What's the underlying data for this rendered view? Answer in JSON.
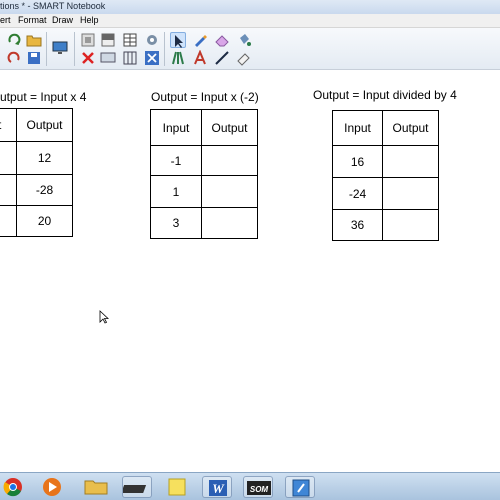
{
  "window": {
    "title": "tions * - SMART Notebook"
  },
  "menu": [
    "ert",
    "Format",
    "Draw",
    "Help"
  ],
  "toolbar": {
    "row1": [
      "redo-icon",
      "open-folder-icon",
      "screen-shade-icon",
      "display-icon",
      "capture-icon",
      "table-icon",
      "properties-icon",
      "scissors-icon",
      "select-arrow-icon",
      "pen-icon",
      "eraser-icon",
      "fill-bucket-icon"
    ],
    "row2": [
      "undo-icon",
      "save-icon",
      "delete-icon",
      "screen-icon",
      "grid-icon",
      "full-screen-icon",
      "creative-pen-icon",
      "text-icon",
      "line-icon",
      "magic-eraser-icon"
    ]
  },
  "tables": [
    {
      "rule": "utput = Input x 4",
      "headers": [
        "Input",
        "Output"
      ],
      "header_input_visible": "put",
      "rows": [
        [
          "",
          "12"
        ],
        [
          "",
          "-28"
        ],
        [
          "",
          "20"
        ]
      ]
    },
    {
      "rule": "Output = Input x (-2)",
      "headers": [
        "Input",
        "Output"
      ],
      "rows": [
        [
          "-1",
          ""
        ],
        [
          "1",
          ""
        ],
        [
          "3",
          ""
        ]
      ]
    },
    {
      "rule": "Output = Input divided by 4",
      "headers": [
        "Input",
        "Output"
      ],
      "rows": [
        [
          "16",
          ""
        ],
        [
          "-24",
          ""
        ],
        [
          "36",
          ""
        ]
      ]
    }
  ],
  "taskbar": {
    "items": [
      "chrome-icon",
      "media-player-icon",
      "folder-icon",
      "smart-board-icon",
      "word-icon",
      "som-app-icon",
      "notebook-icon"
    ],
    "som_label": "SOM",
    "word_label": "W"
  },
  "colors": {
    "accent": "#3a6fc4",
    "taskbar": "#b8cfe8"
  }
}
